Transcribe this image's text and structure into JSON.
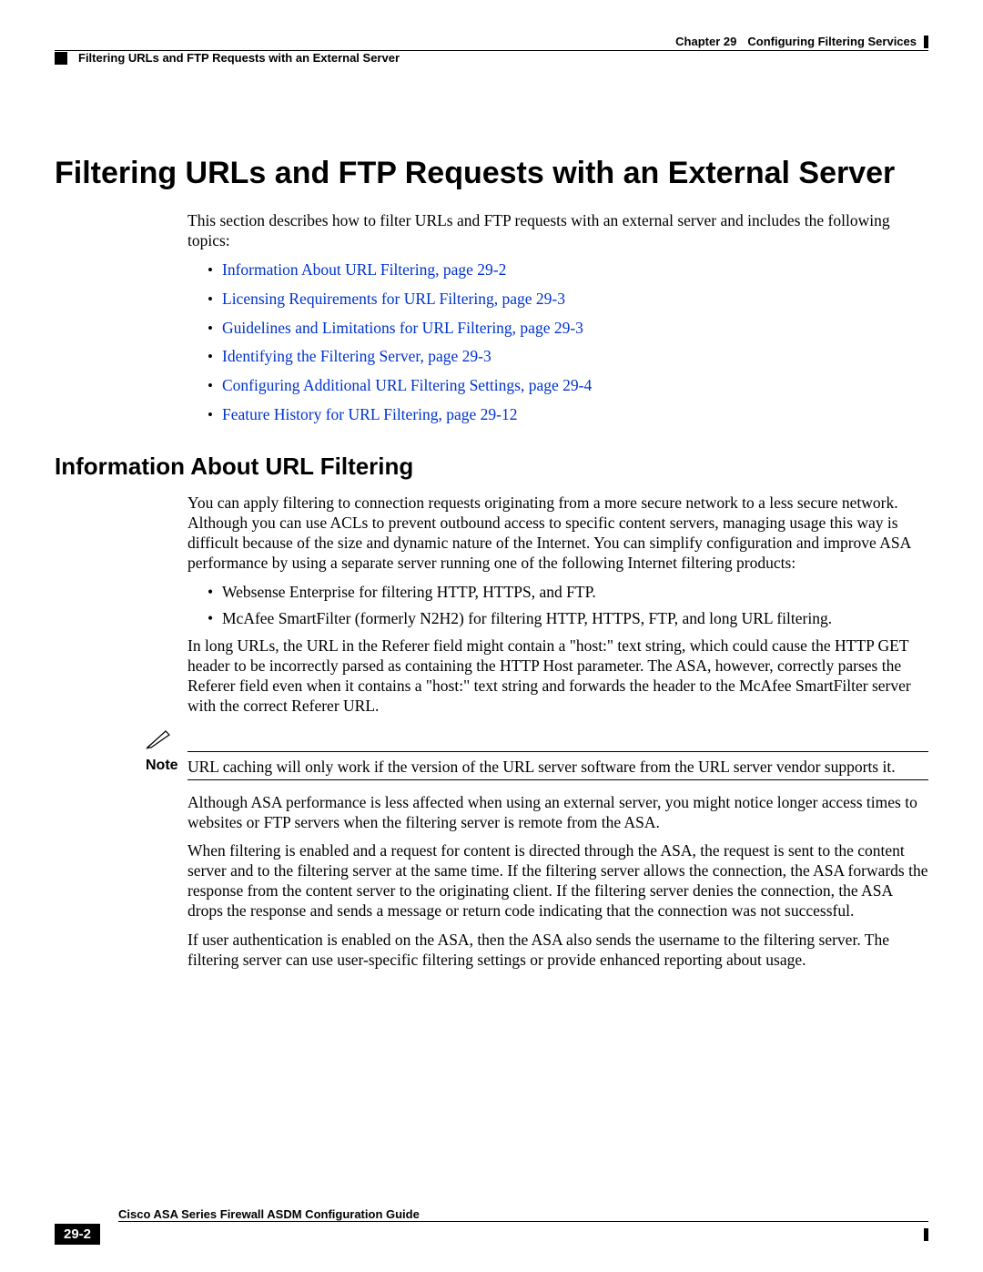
{
  "header": {
    "chapter_label": "Chapter 29",
    "chapter_title": "Configuring Filtering Services",
    "breadcrumb": "Filtering URLs and FTP Requests with an External Server"
  },
  "title": "Filtering URLs and FTP Requests with an External Server",
  "intro": "This section describes how to filter URLs and FTP requests with an external server and includes the following topics:",
  "links": [
    "Information About URL Filtering, page 29-2",
    "Licensing Requirements for URL Filtering, page 29-3",
    "Guidelines and Limitations for URL Filtering, page 29-3",
    "Identifying the Filtering Server, page 29-3",
    "Configuring Additional URL Filtering Settings, page 29-4",
    "Feature History for URL Filtering, page 29-12"
  ],
  "section_heading": "Information About URL Filtering",
  "para1": "You can apply filtering to connection requests originating from a more secure network to a less secure network. Although you can use ACLs to prevent outbound access to specific content servers, managing usage this way is difficult because of the size and dynamic nature of the Internet. You can simplify configuration and improve ASA performance by using a separate server running one of the following Internet filtering products:",
  "bullets": [
    "Websense Enterprise for filtering HTTP, HTTPS, and FTP.",
    "McAfee SmartFilter (formerly N2H2) for filtering HTTP, HTTPS, FTP, and long URL filtering."
  ],
  "bullet2_detail": "In long URLs, the URL in the Referer field might contain a \"host:\" text string, which could cause the HTTP GET header to be incorrectly parsed as containing the HTTP Host parameter. The ASA, however, correctly parses the Referer field even when it contains a \"host:\" text string and forwards the header to the McAfee SmartFilter server with the correct Referer URL.",
  "note_label": "Note",
  "note_text": "URL caching will only work if the version of the URL server software from the URL server vendor supports it.",
  "para2": "Although ASA performance is less affected when using an external server, you might notice longer access times to websites or FTP servers when the filtering server is remote from the ASA.",
  "para3": "When filtering is enabled and a request for content is directed through the ASA, the request is sent to the content server and to the filtering server at the same time. If the filtering server allows the connection, the ASA forwards the response from the content server to the originating client. If the filtering server denies the connection, the ASA drops the response and sends a message or return code indicating that the connection was not successful.",
  "para4": "If user authentication is enabled on the ASA, then the ASA also sends the username to the filtering server. The filtering server can use user-specific filtering settings or provide enhanced reporting about usage.",
  "footer": {
    "guide_title": "Cisco ASA Series Firewall ASDM Configuration Guide",
    "page_number": "29-2"
  }
}
